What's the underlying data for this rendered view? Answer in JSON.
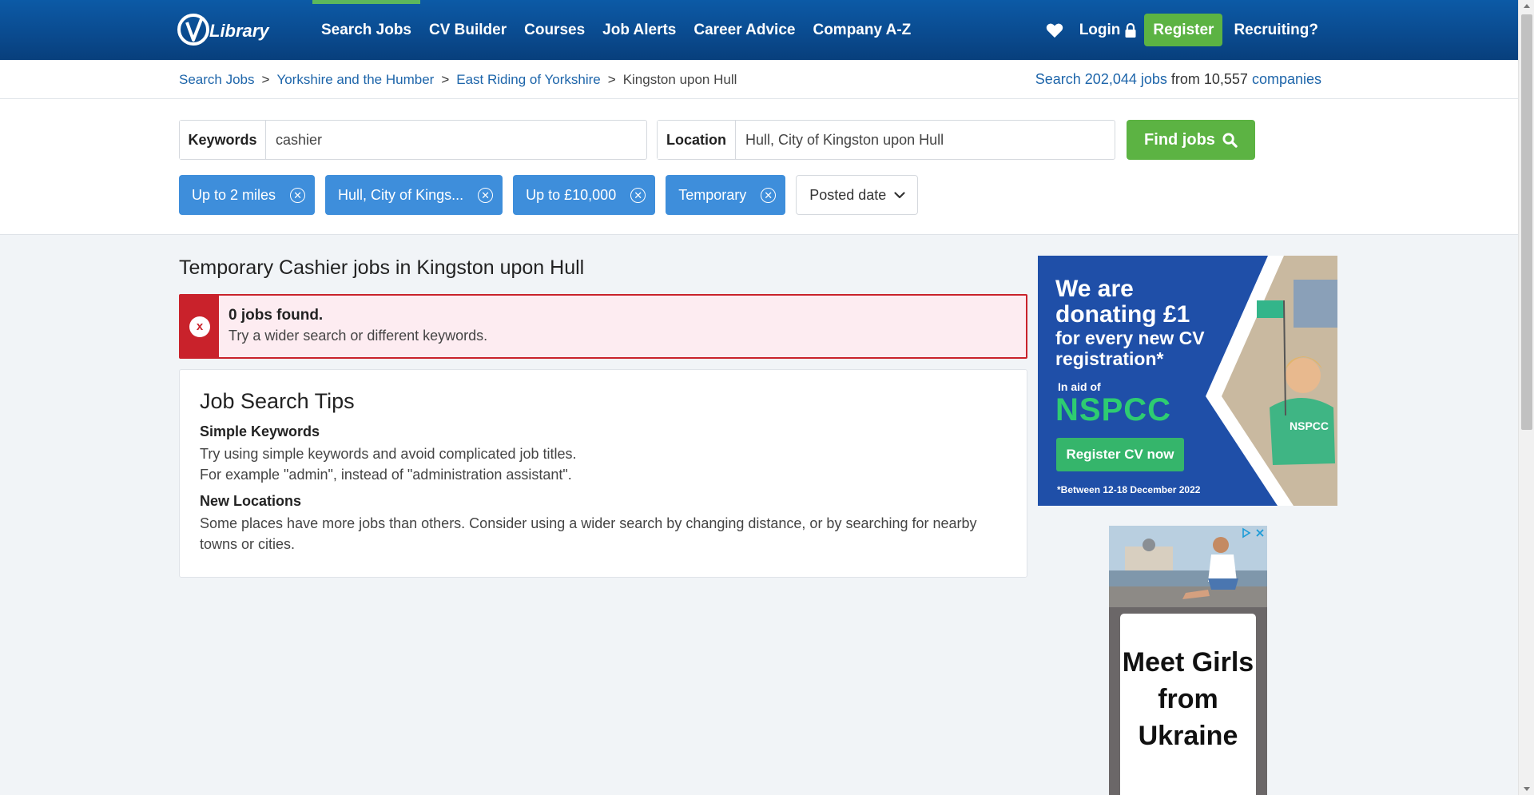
{
  "header": {
    "logo_text": "CV Library",
    "nav": [
      {
        "label": "Search Jobs",
        "active": true
      },
      {
        "label": "CV Builder",
        "active": false
      },
      {
        "label": "Courses",
        "active": false
      },
      {
        "label": "Job Alerts",
        "active": false
      },
      {
        "label": "Career Advice",
        "active": false
      },
      {
        "label": "Company A-Z",
        "active": false
      }
    ],
    "login_label": "Login",
    "register_label": "Register",
    "recruiting_label": "Recruiting?"
  },
  "breadcrumb": {
    "items": [
      "Search Jobs",
      "Yorkshire and the Humber",
      "East Riding of Yorkshire"
    ],
    "separator": ">",
    "current": "Kingston upon Hull"
  },
  "job_count": {
    "prefix": "Search ",
    "jobs": "202,044 jobs",
    "middle": " from 10,557 ",
    "companies": "companies"
  },
  "search": {
    "keywords_label": "Keywords",
    "keywords_value": "cashier",
    "location_label": "Location",
    "location_value": "Hull, City of Kingston upon Hull",
    "find_label": "Find jobs"
  },
  "filters": [
    {
      "label": "Up to 2 miles"
    },
    {
      "label": "Hull, City of Kings..."
    },
    {
      "label": "Up to £10,000"
    },
    {
      "label": "Temporary"
    }
  ],
  "sort_dropdown": "Posted date",
  "page_heading": "Temporary Cashier jobs in Kingston upon Hull",
  "alert": {
    "title": "0 jobs found.",
    "message": "Try a wider search or different keywords."
  },
  "tips": {
    "title": "Job Search Tips",
    "sections": [
      {
        "heading": "Simple Keywords",
        "lines": [
          "Try using simple keywords and avoid complicated job titles.",
          "For example \"admin\", instead of \"administration assistant\"."
        ]
      },
      {
        "heading": "New Locations",
        "lines": [
          "Some places have more jobs than others. Consider using a wider search by changing distance, or by searching for nearby towns or cities."
        ]
      }
    ]
  },
  "ad_nspcc": {
    "line1": "We are",
    "line2": "donating £1",
    "line3": "for every new CV",
    "line4": "registration*",
    "in_aid": "In aid of",
    "charity": "NSPCC",
    "button": "Register CV now",
    "footnote": "*Between 12-18 December 2022",
    "shirt_text": "NSPCC"
  },
  "ad_dating": {
    "text_lines": [
      "Meet Girls",
      "from",
      "Ukraine"
    ]
  },
  "colors": {
    "header_blue": "#0a4a8e",
    "accent_green": "#5cb343",
    "chip_blue": "#3e8edb",
    "link_blue": "#1d65aa",
    "alert_red": "#c9222b"
  }
}
